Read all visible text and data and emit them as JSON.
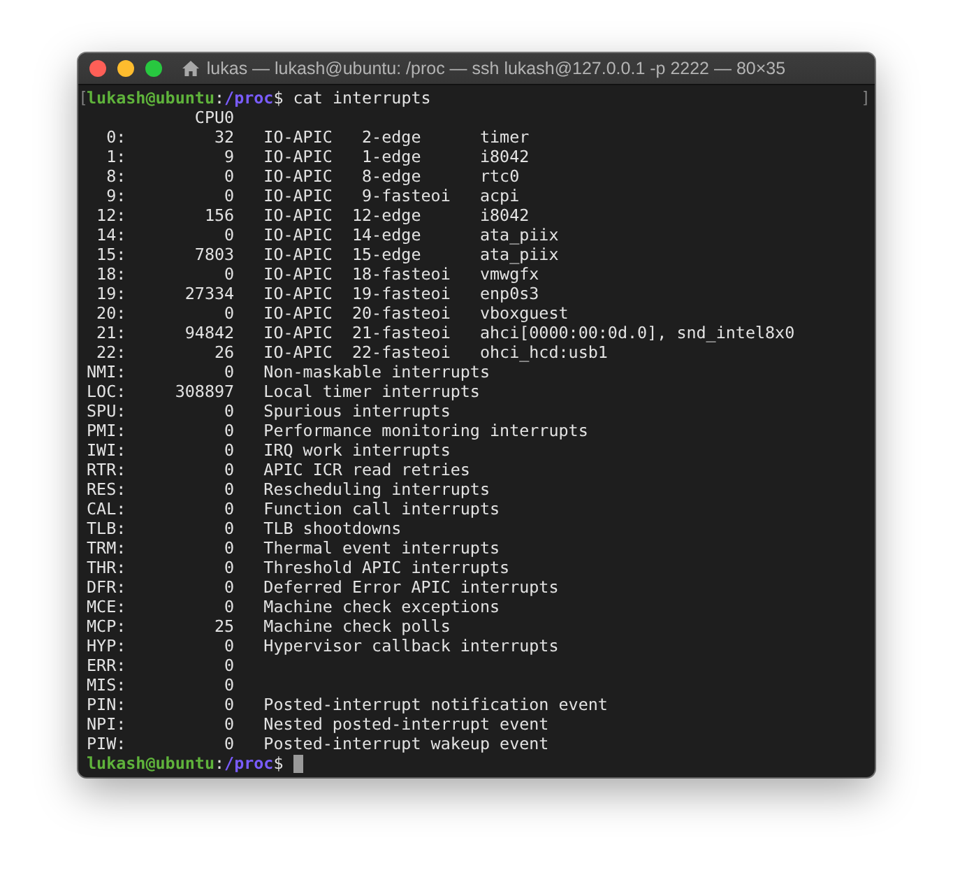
{
  "window": {
    "title": "lukas — lukash@ubuntu: /proc — ssh lukash@127.0.0.1 -p 2222 — 80×35"
  },
  "terminal": {
    "marks": {
      "open": "[",
      "close": "]"
    },
    "command": {
      "user_host": "lukash@ubuntu",
      "separator": ":",
      "path": "/proc",
      "symbol": "$",
      "text": "cat interrupts"
    },
    "lines": [
      "           CPU0",
      "  0:         32   IO-APIC   2-edge      timer",
      "  1:          9   IO-APIC   1-edge      i8042",
      "  8:          0   IO-APIC   8-edge      rtc0",
      "  9:          0   IO-APIC   9-fasteoi   acpi",
      " 12:        156   IO-APIC  12-edge      i8042",
      " 14:          0   IO-APIC  14-edge      ata_piix",
      " 15:       7803   IO-APIC  15-edge      ata_piix",
      " 18:          0   IO-APIC  18-fasteoi   vmwgfx",
      " 19:      27334   IO-APIC  19-fasteoi   enp0s3",
      " 20:          0   IO-APIC  20-fasteoi   vboxguest",
      " 21:      94842   IO-APIC  21-fasteoi   ahci[0000:00:0d.0], snd_intel8x0",
      " 22:         26   IO-APIC  22-fasteoi   ohci_hcd:usb1",
      "NMI:          0   Non-maskable interrupts",
      "LOC:     308897   Local timer interrupts",
      "SPU:          0   Spurious interrupts",
      "PMI:          0   Performance monitoring interrupts",
      "IWI:          0   IRQ work interrupts",
      "RTR:          0   APIC ICR read retries",
      "RES:          0   Rescheduling interrupts",
      "CAL:          0   Function call interrupts",
      "TLB:          0   TLB shootdowns",
      "TRM:          0   Thermal event interrupts",
      "THR:          0   Threshold APIC interrupts",
      "DFR:          0   Deferred Error APIC interrupts",
      "MCE:          0   Machine check exceptions",
      "MCP:         25   Machine check polls",
      "HYP:          0   Hypervisor callback interrupts",
      "ERR:          0",
      "MIS:          0",
      "PIN:          0   Posted-interrupt notification event",
      "NPI:          0   Nested posted-interrupt event",
      "PIW:          0   Posted-interrupt wakeup event"
    ],
    "prompt": {
      "user_host": "lukash@ubuntu",
      "separator": ":",
      "path": "/proc",
      "symbol": "$"
    }
  }
}
